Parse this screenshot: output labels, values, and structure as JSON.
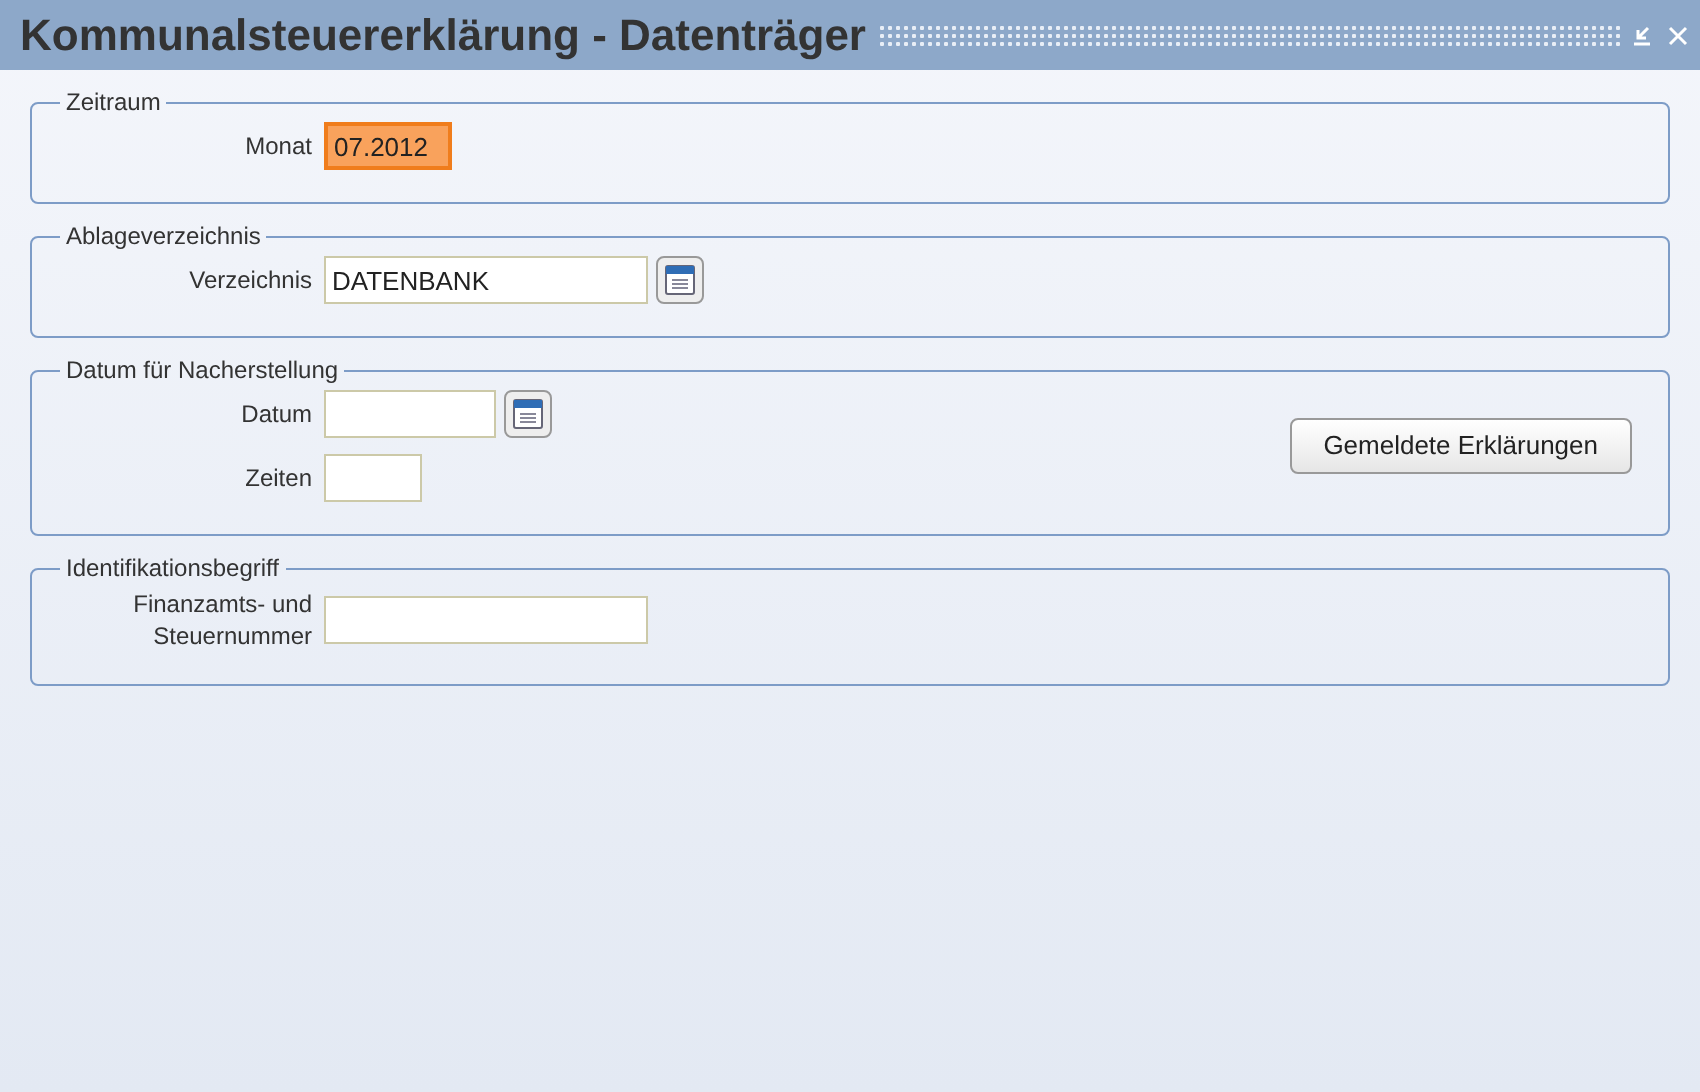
{
  "window": {
    "title": "Kommunalsteuererklärung - Datenträger"
  },
  "groups": [
    {
      "legend": "Zeitraum",
      "fields": [
        {
          "kind": "month",
          "label": "Monat",
          "value": "07.2012",
          "focused": true,
          "picker": false
        }
      ]
    },
    {
      "legend": "Ablageverzeichnis",
      "fields": [
        {
          "kind": "path",
          "label": "Verzeichnis",
          "value": "DATENBANK",
          "focused": false,
          "picker": true
        }
      ]
    },
    {
      "legend": "Datum für Nacherstellung",
      "fields": [
        {
          "kind": "date",
          "label": "Datum",
          "focused": false,
          "picker": true
        },
        {
          "kind": "count",
          "label": "Zeiten",
          "focused": false,
          "picker": false
        }
      ],
      "button": "Gemeldete Erklärungen"
    },
    {
      "legend": "Identifikationsbegriff",
      "fields": [
        {
          "kind": "id",
          "label": "Finanzamts- und Steuernummer",
          "focused": false,
          "picker": false
        }
      ]
    }
  ]
}
